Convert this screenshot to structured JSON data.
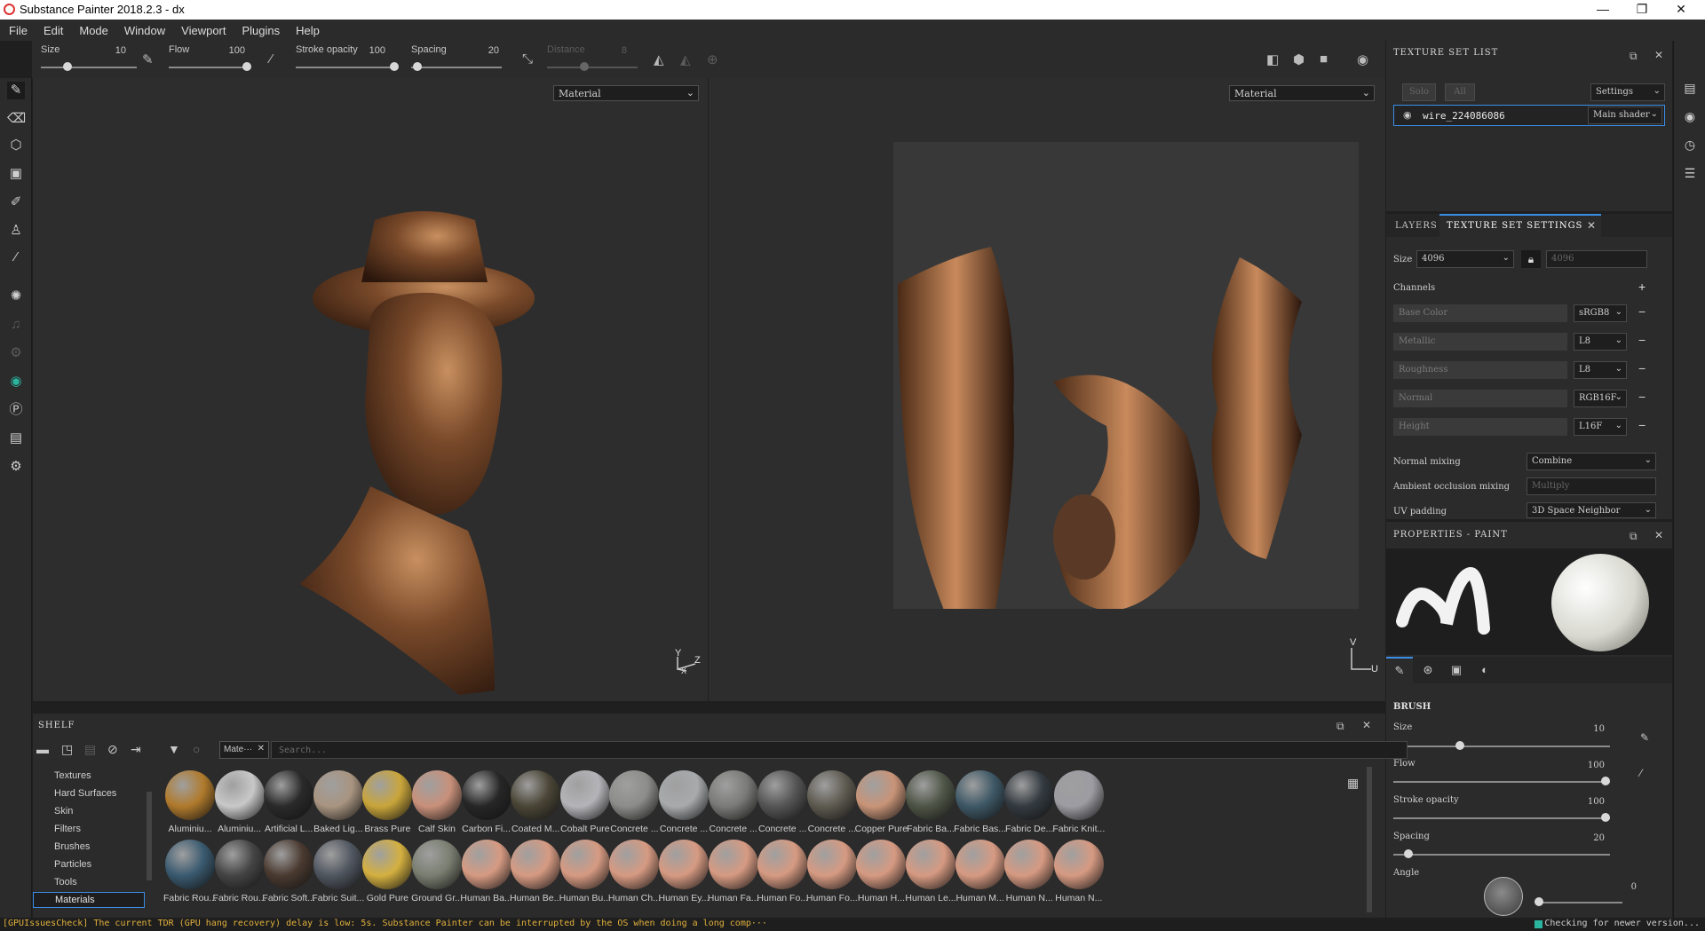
{
  "window": {
    "title": "Substance Painter 2018.2.3 - dx",
    "minimize": "—",
    "maximize": "❐",
    "close": "✕"
  },
  "menu": [
    "File",
    "Edit",
    "Mode",
    "Window",
    "Viewport",
    "Plugins",
    "Help"
  ],
  "toolbar": {
    "size_label": "Size",
    "size_value": "10",
    "flow_label": "Flow",
    "flow_value": "100",
    "stroke_label": "Stroke opacity",
    "stroke_value": "100",
    "spacing_label": "Spacing",
    "spacing_value": "20",
    "distance_label": "Distance",
    "distance_value": "8"
  },
  "viewports": {
    "left_select": "Material",
    "right_select": "Material",
    "axis_left": {
      "y": "Y",
      "z": "Z",
      "x": "X"
    },
    "axis_right": {
      "v": "V",
      "u": "U"
    }
  },
  "texture_set_list": {
    "title": "TEXTURE SET LIST",
    "solo": "Solo",
    "all": "All",
    "settings": "Settings",
    "item_name": "wire_224086086",
    "item_shader": "Main shader"
  },
  "texture_set_settings": {
    "tab_layers": "LAYERS",
    "tab_settings": "TEXTURE SET SETTINGS",
    "size_label": "Size",
    "size_value": "4096",
    "size_locked_value": "4096",
    "channels_label": "Channels",
    "channels": [
      {
        "name": "Base Color",
        "format": "sRGB8"
      },
      {
        "name": "Metallic",
        "format": "L8"
      },
      {
        "name": "Roughness",
        "format": "L8"
      },
      {
        "name": "Normal",
        "format": "RGB16F"
      },
      {
        "name": "Height",
        "format": "L16F"
      }
    ],
    "normal_mixing_label": "Normal mixing",
    "normal_mixing_value": "Combine",
    "ao_mixing_label": "Ambient occlusion mixing",
    "ao_mixing_value": "Multiply",
    "uv_padding_label": "UV padding",
    "uv_padding_value": "3D Space Neighbor"
  },
  "properties": {
    "title": "PROPERTIES - PAINT",
    "brush_title": "BRUSH",
    "size_label": "Size",
    "size_value": "10",
    "size_fraction": 0.3,
    "flow_label": "Flow",
    "flow_value": "100",
    "flow_fraction": 1.0,
    "stroke_label": "Stroke opacity",
    "stroke_value": "100",
    "stroke_fraction": 1.0,
    "spacing_label": "Spacing",
    "spacing_value": "20",
    "spacing_fraction": 0.05,
    "angle_label": "Angle",
    "angle_value": "0"
  },
  "shelf": {
    "title": "SHELF",
    "filter_tag": "Mate···",
    "search_placeholder": "Search...",
    "categories": [
      "Textures",
      "Hard Surfaces",
      "Skin",
      "Filters",
      "Brushes",
      "Particles",
      "Tools",
      "Materials"
    ],
    "selected_category": "Materials",
    "row1": [
      {
        "name": "Aluminiu...",
        "color": "#b07a2c"
      },
      {
        "name": "Aluminiu...",
        "color": "#c8c8c8"
      },
      {
        "name": "Artificial L...",
        "color": "#2a2a2a"
      },
      {
        "name": "Baked Lig...",
        "color": "#a89480"
      },
      {
        "name": "Brass Pure",
        "color": "#c9a53a"
      },
      {
        "name": "Calf Skin",
        "color": "#c8907a"
      },
      {
        "name": "Carbon Fi...",
        "color": "#262626"
      },
      {
        "name": "Coated M...",
        "color": "#4a4536"
      },
      {
        "name": "Cobalt Pure",
        "color": "#b4b4b8"
      },
      {
        "name": "Concrete ...",
        "color": "#8c8c8a"
      },
      {
        "name": "Concrete ...",
        "color": "#a8aaac"
      },
      {
        "name": "Concrete ...",
        "color": "#7a7a78"
      },
      {
        "name": "Concrete ...",
        "color": "#555555"
      },
      {
        "name": "Concrete ...",
        "color": "#5e5a50"
      },
      {
        "name": "Copper Pure",
        "color": "#c89478"
      },
      {
        "name": "Fabric Ba...",
        "color": "#4e5546"
      },
      {
        "name": "Fabric Bas...",
        "color": "#3e5866"
      },
      {
        "name": "Fabric De...",
        "color": "#333a40"
      },
      {
        "name": "Fabric Knit...",
        "color": "#9c9ca2"
      }
    ],
    "row2": [
      {
        "name": "Fabric Rou...",
        "color": "#3a5a70"
      },
      {
        "name": "Fabric Rou...",
        "color": "#444444"
      },
      {
        "name": "Fabric Soft...",
        "color": "#4a3a30"
      },
      {
        "name": "Fabric Suit...",
        "color": "#505660"
      },
      {
        "name": "Gold Pure",
        "color": "#d4b040"
      },
      {
        "name": "Ground Gr...",
        "color": "#7a7e70"
      },
      {
        "name": "Human Ba...",
        "color": "#d69a82"
      },
      {
        "name": "Human Be...",
        "color": "#d69a82"
      },
      {
        "name": "Human Bu...",
        "color": "#d69a82"
      },
      {
        "name": "Human Ch...",
        "color": "#d69a82"
      },
      {
        "name": "Human Ey...",
        "color": "#d69a82"
      },
      {
        "name": "Human Fa...",
        "color": "#d69a82"
      },
      {
        "name": "Human Fo...",
        "color": "#d69a82"
      },
      {
        "name": "Human Fo...",
        "color": "#d69a82"
      },
      {
        "name": "Human H...",
        "color": "#d69a82"
      },
      {
        "name": "Human Le...",
        "color": "#d69a82"
      },
      {
        "name": "Human M...",
        "color": "#d69a82"
      },
      {
        "name": "Human N...",
        "color": "#d69a82"
      },
      {
        "name": "Human N...",
        "color": "#d69a82"
      }
    ]
  },
  "status": {
    "message": "[GPUIssuesCheck] The current TDR (GPU hang recovery) delay is low: 5s. Substance Painter can be interrupted by the OS when doing a long comp···",
    "right": "Checking for newer version..."
  },
  "colors": {
    "accent": "#3a8ee6",
    "status_warning": "#e2b13c",
    "status_ok": "#2bb5a0"
  }
}
